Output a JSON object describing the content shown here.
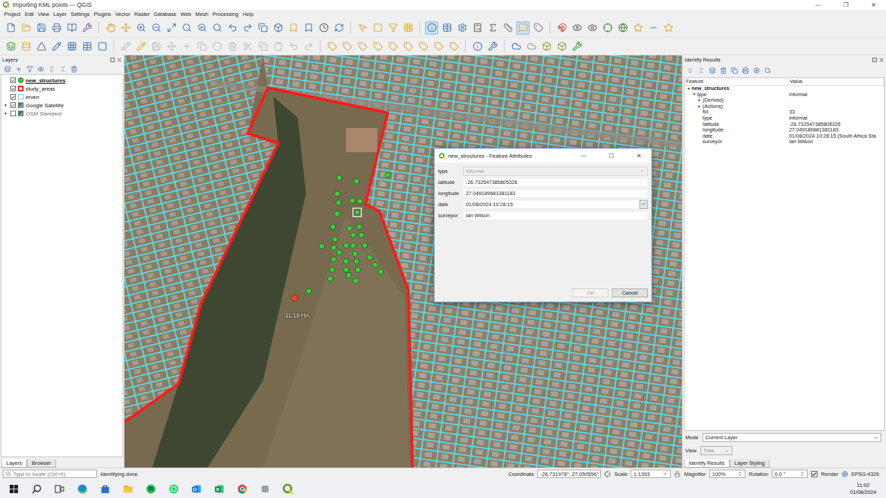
{
  "window": {
    "title": "Importing KML points — QGIS",
    "controls": [
      "—",
      "❐",
      "✕"
    ]
  },
  "menu": [
    "Project",
    "Edit",
    "View",
    "Layer",
    "Settings",
    "Plugins",
    "Vector",
    "Raster",
    "Database",
    "Web",
    "Mesh",
    "Processing",
    "Help"
  ],
  "toolbar_1": {
    "buttons": [
      {
        "active": false
      },
      {
        "active": false
      },
      {
        "active": false
      },
      {
        "active": false
      },
      {
        "active": false
      },
      {
        "active": false
      },
      {
        "active": false
      },
      {
        "active": false
      },
      {
        "active": false
      },
      {
        "active": false
      },
      {
        "active": false
      },
      {
        "active": false
      },
      {
        "active": false
      },
      {
        "active": false
      },
      {
        "active": false
      },
      {
        "active": false
      },
      {
        "active": false
      },
      {
        "active": false
      },
      {
        "active": false
      },
      {
        "active": false
      },
      {
        "active": false
      },
      {
        "active": false
      },
      {
        "active": false
      },
      {
        "active": false
      },
      {
        "active": false
      },
      {
        "active": false
      },
      {
        "active": true
      },
      {
        "active": false
      },
      {
        "active": false
      },
      {
        "active": false
      },
      {
        "active": false
      },
      {
        "active": false
      },
      {
        "active": true
      },
      {
        "active": false
      },
      {
        "active": false
      },
      {
        "active": false
      },
      {
        "active": false
      },
      {
        "active": false
      },
      {
        "active": false
      },
      {
        "active": false
      },
      {
        "active": false
      },
      {
        "active": false
      }
    ]
  },
  "toolbar_2": {
    "buttons": [
      {
        "disabled": false
      },
      {
        "disabled": false
      },
      {
        "disabled": false
      },
      {
        "disabled": false
      },
      {
        "disabled": false
      },
      {
        "disabled": false
      },
      {
        "disabled": false
      },
      {
        "disabled": true
      },
      {
        "disabled": false
      },
      {
        "disabled": true
      },
      {
        "disabled": true
      },
      {
        "disabled": true
      },
      {
        "disabled": true
      },
      {
        "disabled": true
      },
      {
        "disabled": true
      },
      {
        "disabled": true
      },
      {
        "disabled": true
      },
      {
        "disabled": true
      },
      {
        "disabled": true
      },
      {
        "disabled": true
      },
      {
        "disabled": false
      },
      {
        "disabled": false
      },
      {
        "disabled": false
      },
      {
        "disabled": false
      },
      {
        "disabled": false
      },
      {
        "disabled": false
      },
      {
        "disabled": false
      },
      {
        "disabled": false
      },
      {
        "disabled": false
      },
      {
        "disabled": false
      },
      {
        "disabled": false
      },
      {
        "disabled": false
      },
      {
        "disabled": false
      },
      {
        "disabled": false
      },
      {
        "disabled": false
      },
      {
        "disabled": false
      }
    ]
  },
  "layers_panel": {
    "title": "Layers",
    "items": [
      {
        "name": "new_structures",
        "kind": "point",
        "checked": true,
        "selected": true,
        "disabled": false,
        "expanded": false,
        "color": "#35d035"
      },
      {
        "name": "study_areas",
        "kind": "polygon",
        "checked": true,
        "selected": false,
        "disabled": false,
        "expanded": false,
        "color": "#e31a1c"
      },
      {
        "name": "erven",
        "kind": "outline",
        "checked": true,
        "selected": false,
        "disabled": false,
        "expanded": false,
        "color": "#5fd6e6"
      },
      {
        "name": "Google Satellite",
        "kind": "raster",
        "checked": true,
        "selected": false,
        "disabled": false,
        "expanded": false
      },
      {
        "name": "OSM Standard",
        "kind": "raster",
        "checked": false,
        "selected": false,
        "disabled": true,
        "expanded": false
      }
    ],
    "tabs": [
      {
        "label": "Layers",
        "selected": true
      },
      {
        "label": "Browser",
        "selected": false
      }
    ]
  },
  "map": {
    "area_label": "11.19 HA",
    "points": [
      {
        "selected": false,
        "editing": false
      },
      {
        "selected": false,
        "editing": false
      },
      {
        "selected": false,
        "editing": false
      },
      {
        "selected": false,
        "editing": false
      },
      {
        "selected": false,
        "editing": false
      },
      {
        "selected": false,
        "editing": false
      },
      {
        "selected": false,
        "editing": false
      },
      {
        "selected": false,
        "editing": false
      },
      {
        "selected": false,
        "editing": true
      },
      {
        "selected": false,
        "editing": false
      },
      {
        "selected": false,
        "editing": false
      },
      {
        "selected": false,
        "editing": false
      },
      {
        "selected": false,
        "editing": false
      },
      {
        "selected": false,
        "editing": false
      },
      {
        "selected": false,
        "editing": false
      },
      {
        "selected": false,
        "editing": false
      },
      {
        "selected": false,
        "editing": false
      },
      {
        "selected": false,
        "editing": false
      },
      {
        "selected": false,
        "editing": false
      },
      {
        "selected": false,
        "editing": false
      },
      {
        "selected": false,
        "editing": false
      },
      {
        "selected": false,
        "editing": false
      },
      {
        "selected": false,
        "editing": false
      },
      {
        "selected": false,
        "editing": false
      },
      {
        "selected": false,
        "editing": false
      },
      {
        "selected": false,
        "editing": false
      },
      {
        "selected": false,
        "editing": false
      },
      {
        "selected": false,
        "editing": false
      },
      {
        "selected": false,
        "editing": false
      },
      {
        "selected": false,
        "editing": false
      },
      {
        "selected": false,
        "editing": false
      },
      {
        "selected": false,
        "editing": false
      },
      {
        "selected": false,
        "editing": false
      },
      {
        "selected": false,
        "editing": false
      },
      {
        "selected": false,
        "editing": false
      },
      {
        "selected": true,
        "editing": false
      }
    ]
  },
  "dialog": {
    "title": "new_structures - Feature Attributes",
    "controls": [
      "—",
      "☐",
      "✕"
    ],
    "fields": [
      {
        "label": "type",
        "value": "informal",
        "kind": "combo",
        "disabled": true
      },
      {
        "label": "latitude",
        "value": "-26.732547385805326",
        "kind": "text",
        "disabled": false
      },
      {
        "label": "longitude",
        "value": "27.049189681381183",
        "kind": "text",
        "disabled": false
      },
      {
        "label": "date",
        "value": "01/08/2024 10:28:15",
        "kind": "datetime",
        "disabled": false
      },
      {
        "label": "surveyor",
        "value": "Ian Wilson",
        "kind": "text",
        "disabled": false
      }
    ],
    "buttons": [
      {
        "label": "OK",
        "disabled": true
      },
      {
        "label": "Cancel",
        "disabled": false
      }
    ]
  },
  "identify": {
    "title": "Identify Results",
    "columns": [
      "Feature",
      "Value"
    ],
    "rows": [
      {
        "feature": "new_structures",
        "kind": "layer",
        "expanded": true
      },
      {
        "feature": "type",
        "value": "informal",
        "kind": "feature",
        "expanded": true
      },
      {
        "feature": "(Derived)",
        "kind": "group",
        "expanded": false
      },
      {
        "feature": "(Actions)",
        "kind": "group",
        "expanded": false
      },
      {
        "feature": "fid",
        "value": "33",
        "kind": "attribute",
        "expanded": false
      },
      {
        "feature": "type",
        "value": "informal",
        "kind": "attribute",
        "expanded": false
      },
      {
        "feature": "latitude",
        "value": "-26.732547385805326",
        "kind": "attribute",
        "expanded": false
      },
      {
        "feature": "longitude",
        "value": "27.049189681381183",
        "kind": "attribute",
        "expanded": false
      },
      {
        "feature": "date",
        "value": "01/08/2024 10:28:15 (South Africa Sta",
        "kind": "attribute",
        "expanded": false
      },
      {
        "feature": "surveyor",
        "value": "Ian Wilson",
        "kind": "attribute",
        "expanded": false
      }
    ],
    "mode": {
      "label": "Mode",
      "value": "Current Layer"
    },
    "view": {
      "label": "View",
      "value": "Tree",
      "disabled": true
    },
    "tabs": [
      {
        "label": "Identify Results",
        "selected": true
      },
      {
        "label": "Layer Styling",
        "selected": false
      }
    ]
  },
  "status_bar": {
    "locate_placeholder": "Type to locate (Ctrl+K)",
    "message": "Identifying done.",
    "coordinate_label": "Coordinate",
    "coordinate": "-26.731978°, 27.050556°",
    "scale_label": "Scale",
    "scale": "1:1393",
    "magnifier_label": "Magnifier",
    "magnifier": "100%",
    "rotation_label": "Rotation",
    "rotation": "0.0 °",
    "render_label": "Render",
    "render_checked": true,
    "crs": "EPSG:4326"
  },
  "taskbar": {
    "time": "11:02",
    "date": "01/08/2024"
  }
}
